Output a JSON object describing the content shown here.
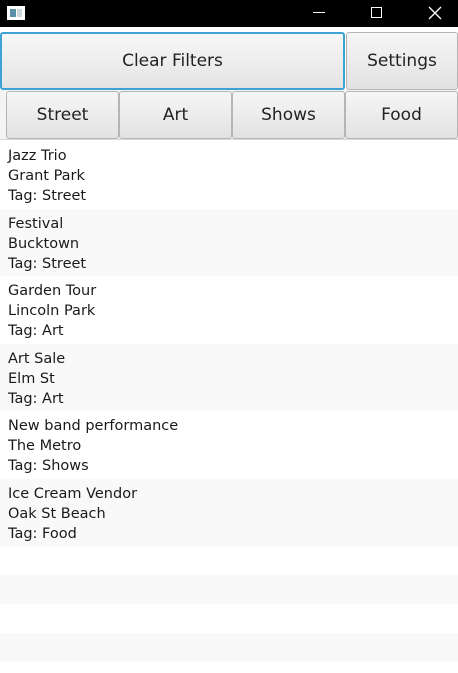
{
  "window": {
    "title": ""
  },
  "toolbar": {
    "clear_filters_label": "Clear Filters",
    "settings_label": "Settings"
  },
  "filters": [
    {
      "label": "Street"
    },
    {
      "label": "Art"
    },
    {
      "label": "Shows"
    },
    {
      "label": "Food"
    }
  ],
  "events": [
    {
      "name": "Jazz Trio",
      "location": "Grant Park",
      "tag": "Tag: Street"
    },
    {
      "name": "Festival",
      "location": "Bucktown",
      "tag": "Tag: Street"
    },
    {
      "name": "Garden Tour",
      "location": "Lincoln Park",
      "tag": "Tag: Art"
    },
    {
      "name": "Art Sale",
      "location": "Elm St",
      "tag": "Tag: Art"
    },
    {
      "name": "New band performance",
      "location": "The Metro",
      "tag": "Tag: Shows"
    },
    {
      "name": "Ice Cream Vendor",
      "location": "Oak St Beach",
      "tag": "Tag: Food"
    }
  ],
  "colors": {
    "titlebar": "#000000",
    "focus_ring": "#3ba3d6",
    "alt_row": "#f9f9f9"
  },
  "icons": {
    "app": "app-window-icon",
    "minimize": "minimize-icon",
    "maximize": "maximize-icon",
    "close": "close-icon"
  }
}
